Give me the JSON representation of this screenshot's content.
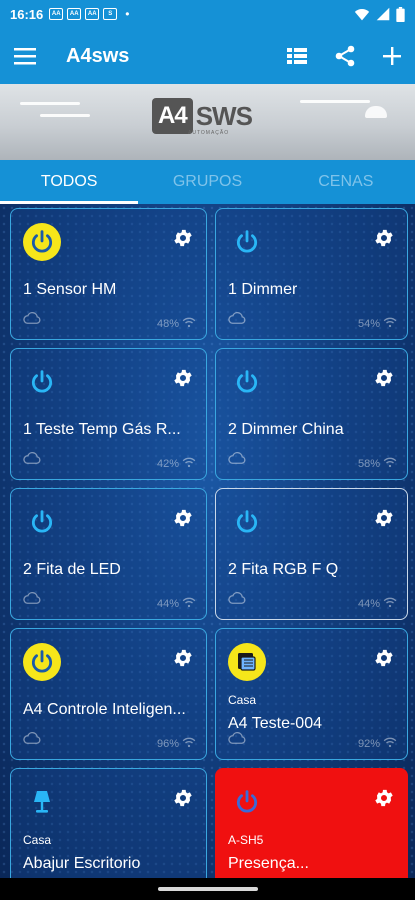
{
  "status_bar": {
    "time": "16:16",
    "notifications": [
      "AA",
      "AA",
      "AA",
      "S"
    ],
    "dot": "•"
  },
  "app_bar": {
    "title": "A4sws",
    "icons": [
      "menu-icon",
      "list-view-icon",
      "share-icon",
      "add-icon"
    ]
  },
  "banner": {
    "logo_main": "A4",
    "logo_suffix": "SWS",
    "logo_sub": "AUTOMAÇÃO"
  },
  "tabs": [
    {
      "label": "TODOS",
      "active": true
    },
    {
      "label": "GRUPOS",
      "active": false
    },
    {
      "label": "CENAS",
      "active": false
    }
  ],
  "devices": [
    {
      "name": "1  Sensor HM",
      "signal": "48%",
      "power_on": true,
      "icon": "power-icon",
      "group": "",
      "variant": ""
    },
    {
      "name": "1 Dimmer",
      "signal": "54%",
      "power_on": false,
      "icon": "power-icon",
      "group": "",
      "variant": ""
    },
    {
      "name": "1 Teste Temp Gás R...",
      "signal": "42%",
      "power_on": false,
      "icon": "power-icon",
      "group": "",
      "variant": ""
    },
    {
      "name": "2 Dimmer China",
      "signal": "58%",
      "power_on": false,
      "icon": "power-icon",
      "group": "",
      "variant": ""
    },
    {
      "name": "2 Fita de LED",
      "signal": "44%",
      "power_on": false,
      "icon": "power-icon",
      "group": "",
      "variant": ""
    },
    {
      "name": "2 Fita RGB F Q",
      "signal": "44%",
      "power_on": false,
      "icon": "power-icon",
      "group": "",
      "variant": "highlight"
    },
    {
      "name": "A4 Controle Inteligen...",
      "signal": "96%",
      "power_on": true,
      "icon": "power-icon",
      "group": "",
      "variant": ""
    },
    {
      "name": "A4 Teste-004",
      "signal": "92%",
      "power_on": true,
      "icon": "curtain-icon",
      "group": "Casa",
      "variant": ""
    },
    {
      "name": "Abajur Escritorio",
      "signal": "",
      "power_on": false,
      "icon": "lamp-icon",
      "group": "Casa",
      "variant": ""
    },
    {
      "name": "Presença...",
      "signal": "",
      "power_on": false,
      "icon": "power-icon",
      "group": "A-SH5",
      "variant": "alert"
    }
  ],
  "colors": {
    "primary": "#1591d6",
    "card_border": "#3aa8e0",
    "power_on_bg": "#f6e61a",
    "icon_blue": "#29b6f6",
    "alert": "#f01010"
  }
}
